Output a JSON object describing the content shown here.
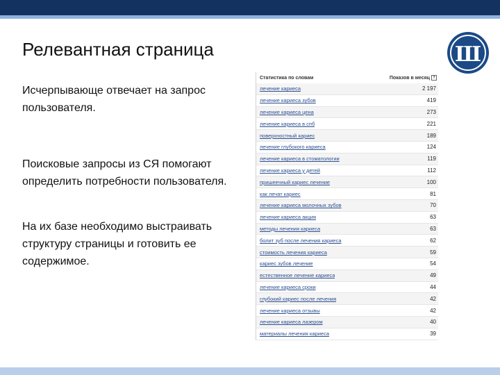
{
  "slide": {
    "title": "Релевантная страница",
    "paragraphs": [
      "Исчерпывающе отвечает на запрос пользователя.",
      "Поисковые запросы из СЯ помогают определить потребности пользователя.",
      "На их базе необходимо выстраивать структуру страницы и готовить ее содержимое."
    ]
  },
  "logo": {
    "icon": "hse-logo-icon",
    "letter": "Ш"
  },
  "stats_table": {
    "col_query": "Статистика по словам",
    "col_shows": "Показов в месяц",
    "rows": [
      {
        "query": "лечение кариеса",
        "count": "2 197"
      },
      {
        "query": "лечение кариеса зубов",
        "count": "419"
      },
      {
        "query": "лечение кариеса цена",
        "count": "273"
      },
      {
        "query": "лечение кариеса в спб",
        "count": "221"
      },
      {
        "query": "поверхностный кариес",
        "count": "189"
      },
      {
        "query": "лечение глубокого кариеса",
        "count": "124"
      },
      {
        "query": "лечение кариеса в стоматологии",
        "count": "119"
      },
      {
        "query": "лечение кариеса у детей",
        "count": "112"
      },
      {
        "query": "пришеечный кариес лечение",
        "count": "100"
      },
      {
        "query": "как лечат кариес",
        "count": "81"
      },
      {
        "query": "лечение кариеса молочных зубов",
        "count": "70"
      },
      {
        "query": "лечение кариеса акция",
        "count": "63"
      },
      {
        "query": "методы лечения кариеса",
        "count": "63"
      },
      {
        "query": "болит зуб после лечения кариеса",
        "count": "62"
      },
      {
        "query": "стоимость лечения кариеса",
        "count": "59"
      },
      {
        "query": "кариес зубов лечение",
        "count": "54"
      },
      {
        "query": "естественное лечение кариеса",
        "count": "49"
      },
      {
        "query": "лечение кариеса сроки",
        "count": "44"
      },
      {
        "query": "глубокий кариес после лечения",
        "count": "42"
      },
      {
        "query": "лечение кариеса отзывы",
        "count": "42"
      },
      {
        "query": "лечение кариеса лазером",
        "count": "40"
      },
      {
        "query": "материалы лечения кариеса",
        "count": "39"
      }
    ]
  },
  "colors": {
    "header_bar": "#14325f",
    "accent_bar": "#8fb1de",
    "link": "#2a4e8f"
  }
}
